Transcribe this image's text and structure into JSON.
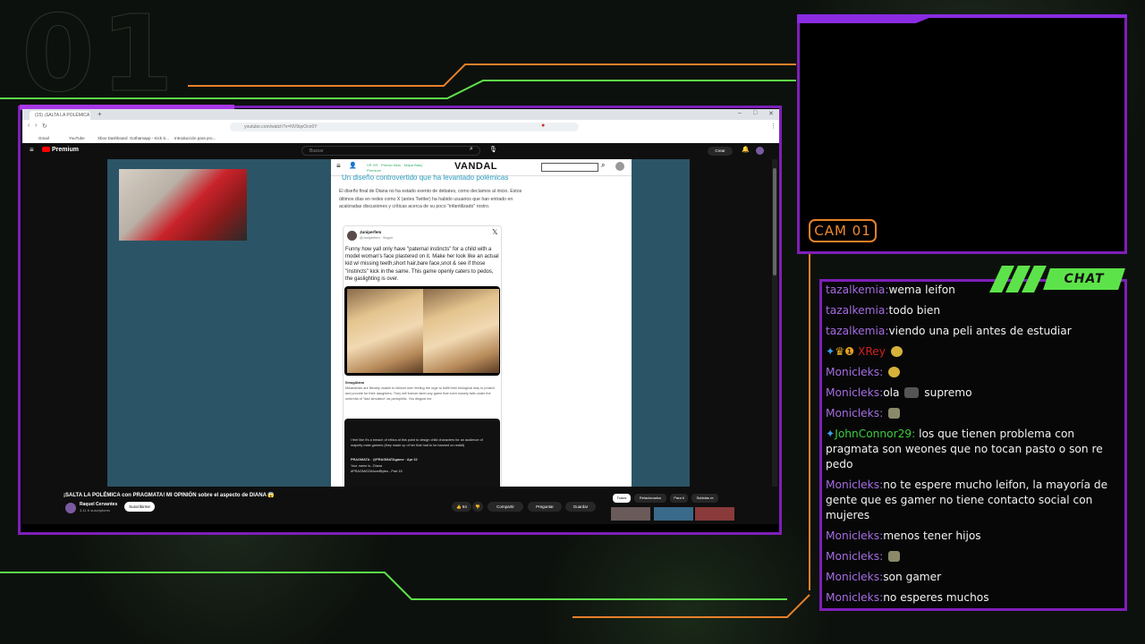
{
  "overlay": {
    "big_number": "01",
    "cam_label": "CAM 01",
    "chat_label": "CHAT",
    "colors": {
      "purple": "#7e1fb8",
      "green": "#5de34a",
      "orange": "#e8802a"
    }
  },
  "browser": {
    "tab_title": "(15) ¡SALTA LA POLÉMICA c...",
    "url": "youtube.com/watch?v=NV9qvOcn0Y",
    "bookmarks": [
      "Gmail",
      "YouTube",
      "Xbox Dashboard",
      "Gothamapp - Kick S...",
      "Introducción para pro..."
    ]
  },
  "youtube": {
    "logo": "Premium",
    "search_placeholder": "Buscar",
    "create_label": "Crear",
    "video_title": "¡SALTA LA POLÉMICA con PRAGMATA! MI OPINIÓN sobre el aspecto de DIANA 😱",
    "channel_name": "Raquel Cervantes",
    "channel_subs": "3,11 K suscriptores",
    "subscribe_label": "Suscribirme",
    "like_count": "64",
    "share_label": "Compartir",
    "ask_label": "Preguntar",
    "save_label": "Guardar",
    "chips": [
      "Todos",
      "Relacionados",
      "Para ti",
      "Subidas re"
    ]
  },
  "article": {
    "site": "VANDAL",
    "menu_items": [
      "VR XR",
      "Premio Nido",
      "Mapa Baby",
      "Premium"
    ],
    "heading": "Un diseño controvertido que ha levantado polémicas",
    "body": "El diseño final de Diana no ha estado exento de debates, como decíamos al inicio. Estos últimos días en redes como X (antes Twitter) ha habido usuarios que han entrado en acaloradas discusiones y críticas acerca de su poco \"infantilizado\" rostro.",
    "tweet": {
      "user": "Juniperfem",
      "handle": "@Juniperfem · Seguir",
      "text": "Funny how yall only have \"paternal instincts\" for a child with a model woman's face plastered on it. Make her look like an actual kid w/ missing teeth,short hair,bare face,snot & see if those \"instincts\" kick in the same. This game openly caters to pedos, the gaslighting is over.",
      "quote_user": "SmugAlana",
      "quote_text": "Misandrists are literally unable to fathom men feeling the urge to fulfill their biological duty to protect and provide for their daughters. They will forever label any game that even loosely falls under the umbrella of \"dad simulator\" as pedophilic. You disgust me.",
      "dark_text": "I feel like it's a breach of ethics at this point to design child characters for an audience of majority male gamers (they made cp of her that had to be banned on reddit)",
      "dark_sub": "PRAGMATA · @PRAGMATAgame · Apr 22",
      "dark_sub2": "Your name is...Diana",
      "dark_sub3": "#PRAGMATANovelBytes - Part 15"
    }
  },
  "chat": [
    {
      "user": "tazalkemia:",
      "color": "purple",
      "text": "wema leifon"
    },
    {
      "user": "tazalkemia:",
      "color": "purple",
      "text": "todo bien"
    },
    {
      "user": "tazalkemia:",
      "color": "purple",
      "text": "viendo una peli antes de estudiar"
    },
    {
      "user": "XRey",
      "color": "red",
      "text": "",
      "badges": true
    },
    {
      "user": "Monicleks:",
      "color": "purple",
      "text": "",
      "emote": "#d6b23a"
    },
    {
      "user": "Monicleks:",
      "color": "purple",
      "text": "ola",
      "text2": "supremo",
      "emote": "#555555"
    },
    {
      "user": "Monicleks:",
      "color": "purple",
      "text": "",
      "emote": "#8a8a6a"
    },
    {
      "user": "JohnConnor29:",
      "color": "green",
      "text": "los que tienen problema con pragmata son weones que no tocan pasto o son re pedo"
    },
    {
      "user": "Monicleks:",
      "color": "purple",
      "text": "no te espere mucho leifon, la mayoría de gente que es gamer no tiene contacto social con mujeres"
    },
    {
      "user": "Monicleks:",
      "color": "purple",
      "text": "menos tener hijos"
    },
    {
      "user": "Monicleks:",
      "color": "purple",
      "text": "",
      "emote": "#8a8a6a"
    },
    {
      "user": "Monicleks:",
      "color": "purple",
      "text": "son gamer"
    },
    {
      "user": "Monicleks:",
      "color": "purple",
      "text": "no esperes muchos"
    }
  ]
}
